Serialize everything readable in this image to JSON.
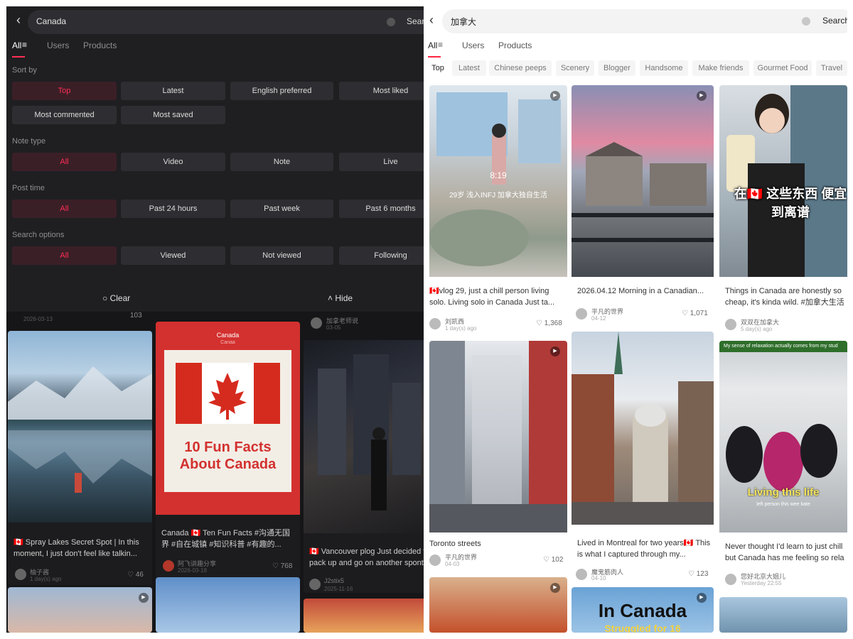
{
  "left": {
    "search": {
      "query": "Canada",
      "button": "Sear"
    },
    "tabs": [
      "All",
      "Users",
      "Products"
    ],
    "sort_by": {
      "label": "Sort by",
      "options": [
        "Top",
        "Latest",
        "English preferred",
        "Most liked",
        "Most commented",
        "Most saved"
      ]
    },
    "note_type": {
      "label": "Note type",
      "options": [
        "All",
        "Video",
        "Note",
        "Live"
      ]
    },
    "post_time": {
      "label": "Post time",
      "options": [
        "All",
        "Past 24 hours",
        "Past week",
        "Past 6 months"
      ]
    },
    "search_options": {
      "label": "Search options",
      "options": [
        "All",
        "Viewed",
        "Not viewed",
        "Following"
      ]
    },
    "footer": {
      "clear": "Clear",
      "hide": "Hide"
    },
    "cards": [
      {
        "text": "🇨🇦 Spray Lakes Secret Spot | In this moment, I just don't feel like talkin...",
        "author": "柚子酱",
        "date": "1 day(s) ago",
        "likes": "46"
      },
      {
        "overlay_title": "Canada",
        "overlay_sub": "Canaa",
        "overlay_big": "10 Fun Facts About Canada",
        "text": "Canada 🇨🇦 Ten Fun Facts #沟通无国界 #自在城镇 #知识科普 #有趣的...",
        "author": "阿飞讲趣分享",
        "date": "2026-03-18",
        "likes": "768"
      },
      {
        "text": "🇨🇦 Vancouver plog Just decided to pack up and go on another spont...",
        "author": "J2stix5",
        "date": "2025-11-16",
        "likes": ""
      },
      {
        "top_author": "加拿老师说",
        "top_date": "03-05",
        "top_date_a": "2026-03-13",
        "top_likes": "103"
      }
    ]
  },
  "right": {
    "search": {
      "query": "加拿大",
      "button": "Search"
    },
    "tabs": [
      "All",
      "Users",
      "Products"
    ],
    "filters": [
      "Top",
      "Latest",
      "Chinese peeps",
      "Scenery",
      "Blogger",
      "Handsome",
      "Make friends",
      "Gourmet Food",
      "Travel"
    ],
    "cards": [
      {
        "duration": "8:19",
        "caption": "29岁 浅入INFJ 加拿大独自生活",
        "text": "🇨🇦vlog 29, just a chill person living solo. Living solo in Canada Just ta...",
        "author": "刘凯西",
        "date": "1 day(s) ago",
        "likes": "1,368"
      },
      {
        "text": "2026.04.12 Morning in a Canadian...",
        "author": "平凡的世界",
        "date": "04-12",
        "likes": "1,071"
      },
      {
        "overlay": "在🇨🇦 这些东西 便宜到离谱",
        "text": "Things in Canada are honestly so cheap, it's kinda wild. #加拿大生活",
        "author": "双双在加拿大",
        "date": "5 day(s) ago",
        "likes": ""
      },
      {
        "text": "Toronto streets",
        "author": "平凡的世界",
        "date": "04-03",
        "likes": "102"
      },
      {
        "text": "Lived in Montreal for two years🇨🇦 This is what I captured through my...",
        "author": "魔鬼筋肉人",
        "date": "04-10",
        "likes": "123"
      },
      {
        "banner": "My sense of relaxation actually comes from my stud",
        "overlay": "Living this life",
        "overlay_sub": "left person this wee kate",
        "text": "Never thought I'd learn to just chill but Canada has me feeling so rela",
        "author": "您好北京大姐儿",
        "date": "Yesterday 22:55",
        "likes": ""
      },
      {
        "overlay": "In Canada",
        "overlay_sub": "Struggled for 16"
      }
    ]
  }
}
